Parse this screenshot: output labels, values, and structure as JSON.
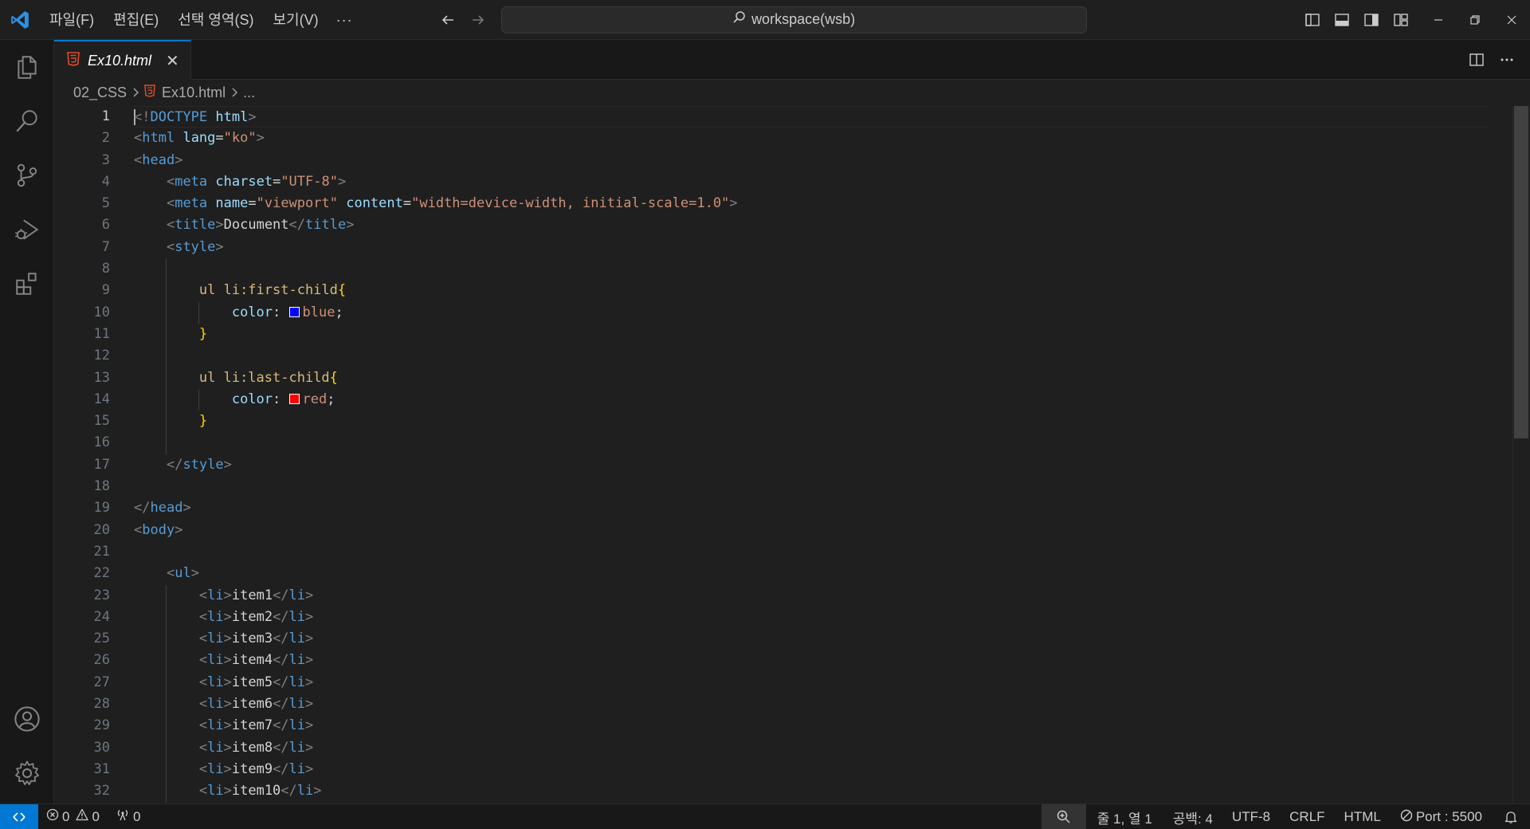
{
  "menu": {
    "items": [
      "파일(F)",
      "편집(E)",
      "선택 영역(S)",
      "보기(V)"
    ],
    "more": "···"
  },
  "search": {
    "text": "workspace(wsb)"
  },
  "tab": {
    "label": "Ex10.html",
    "close": "✕"
  },
  "breadcrumb": {
    "folder": "02_CSS",
    "file": "Ex10.html",
    "more": "..."
  },
  "editor": {
    "active_line": 1,
    "line_numbers": [
      "1",
      "2",
      "3",
      "4",
      "5",
      "6",
      "7",
      "8",
      "9",
      "10",
      "11",
      "12",
      "13",
      "14",
      "15",
      "16",
      "17",
      "18",
      "19",
      "20",
      "21",
      "22",
      "23",
      "24",
      "25",
      "26",
      "27",
      "28",
      "29",
      "30",
      "31",
      "32"
    ],
    "tokens": {
      "doctype_open": "<!",
      "doctype_kw": "DOCTYPE",
      "doctype_html": "html",
      "gt": ">",
      "lt": "<",
      "lt_slash": "</",
      "html": "html",
      "lang": "lang",
      "eq": "=",
      "lang_val": "\"ko\"",
      "head": "head",
      "meta": "meta",
      "charset": "charset",
      "charset_val": "\"UTF-8\"",
      "name": "name",
      "name_val": "\"viewport\"",
      "content": "content",
      "content_val": "\"width=device-width, initial-scale=1.0\"",
      "title": "title",
      "title_text": "Document",
      "style": "style",
      "sel_first": "ul li:first-child",
      "brace_open": "{",
      "brace_close": "}",
      "prop_color": "color",
      "colon": ": ",
      "semicolon": ";",
      "val_blue": "blue",
      "val_red": "red",
      "sel_last": "ul li:last-child",
      "body": "body",
      "ul": "ul",
      "li": "li",
      "items": [
        "item1",
        "item2",
        "item3",
        "item4",
        "item5",
        "item6",
        "item7",
        "item8",
        "item9",
        "item10"
      ]
    },
    "swatch_colors": {
      "blue": "#0000ff",
      "red": "#ff0000"
    }
  },
  "status": {
    "errors": "0",
    "warnings": "0",
    "ports": "0",
    "position": "줄 1, 열 1",
    "indent": "공백: 4",
    "encoding": "UTF-8",
    "eol": "CRLF",
    "language": "HTML",
    "port": "Port : 5500"
  },
  "colors": {
    "accent": "#0078d4",
    "background": "#1f1f1f",
    "html_icon": "#e44d26"
  }
}
